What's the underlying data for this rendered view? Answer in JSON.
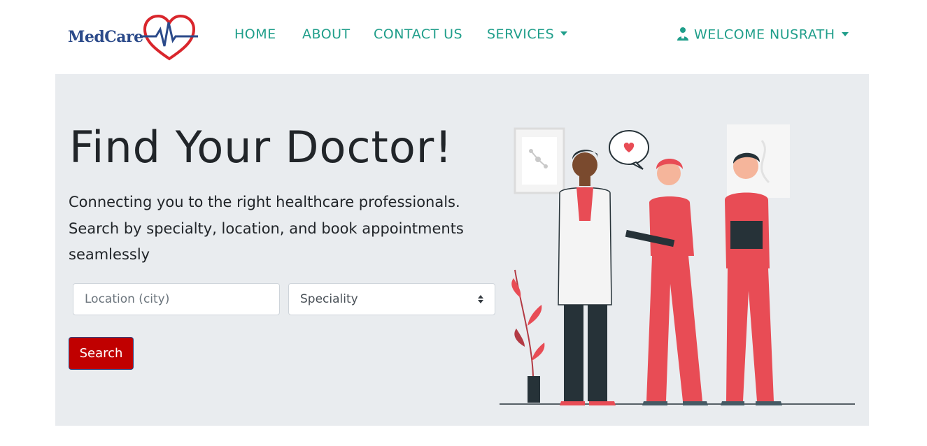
{
  "brand": {
    "name": "MedCare",
    "colors": {
      "text": "#2b4a8a",
      "heart": "#d9262c"
    }
  },
  "nav": {
    "items": [
      {
        "label": "HOME"
      },
      {
        "label": "ABOUT"
      },
      {
        "label": "CONTACT US"
      },
      {
        "label": "SERVICES",
        "has_dropdown": true
      }
    ],
    "user": {
      "label": "WELCOME NUSRATH",
      "icon": "user-icon",
      "has_dropdown": true
    },
    "color": "#1f9e8a"
  },
  "hero": {
    "title": "Find Your Doctor!",
    "description": "Connecting you to the right healthcare professionals. Search by specialty, location, and book appointments seamlessly",
    "location_placeholder": "Location (city)",
    "specialty_selected": "Speciality",
    "search_label": "Search",
    "background": "#e9ecef",
    "button_color": "#c00000",
    "illustration": "doctors-team-illustration"
  }
}
